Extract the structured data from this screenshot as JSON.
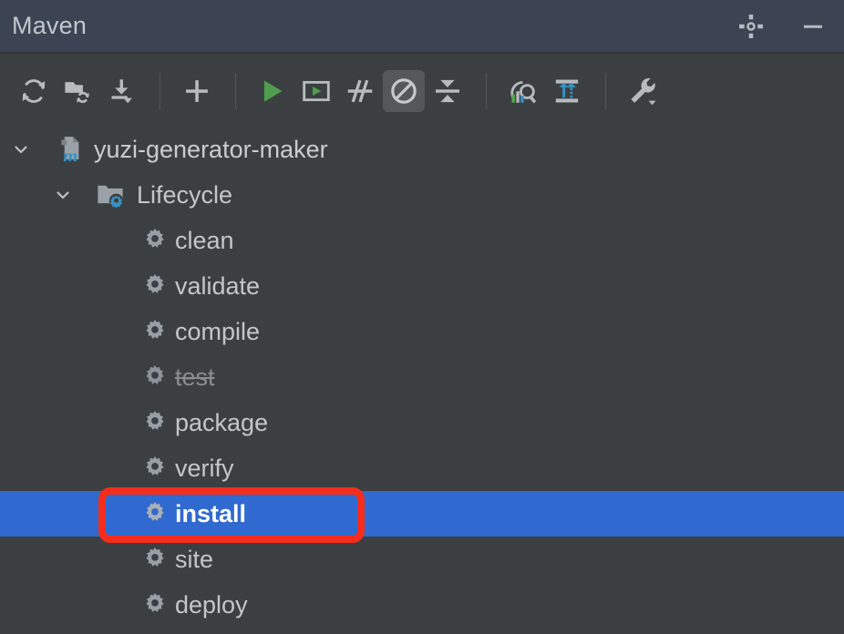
{
  "window": {
    "title": "Maven",
    "actions": [
      {
        "name": "settings-button",
        "icon": "gear-icon"
      },
      {
        "name": "minimize-button",
        "icon": "minimize-icon"
      }
    ]
  },
  "toolbar": {
    "items": [
      {
        "name": "reload-projects-button",
        "icon": "refresh-icon",
        "label": "Reload All Maven Projects",
        "active": false
      },
      {
        "name": "generate-sources-button",
        "icon": "folder-refresh-icon",
        "label": "Generate Sources and Update Folders",
        "active": false
      },
      {
        "name": "download-sources-button",
        "icon": "download-icon",
        "label": "Download Sources and Documentation",
        "active": false
      },
      {
        "name": "add-maven-project-button",
        "icon": "plus-icon",
        "label": "Add Maven Projects",
        "active": false
      },
      {
        "name": "run-maven-build-button",
        "icon": "run-triangle-icon",
        "label": "Run Maven Build",
        "active": false
      },
      {
        "name": "execute-goal-button",
        "icon": "execute-window-icon",
        "label": "Execute Maven Goal",
        "active": false
      },
      {
        "name": "toggle-skip-tests-button",
        "icon": "skip-tests-icon",
        "label": "Toggle 'Skip Tests' Mode",
        "active": false
      },
      {
        "name": "toggle-offline-mode-button",
        "icon": "offline-circle-slash-icon",
        "label": "Toggle Offline Mode",
        "active": true
      },
      {
        "name": "collapse-all-button",
        "icon": "collapse-all-icon",
        "label": "Collapse All",
        "active": false
      },
      {
        "name": "analyze-dependencies-button",
        "icon": "analyze-magnifier-icon",
        "label": "Analyze Dependencies",
        "active": false
      },
      {
        "name": "show-dependency-diagram-button",
        "icon": "dependency-diagram-icon",
        "label": "Show Dependencies",
        "active": false
      },
      {
        "name": "maven-settings-button",
        "icon": "wrench-dropdown-icon",
        "label": "Maven Settings",
        "active": false
      }
    ]
  },
  "tree": {
    "project": {
      "name": "yuzi-generator-maker",
      "icon": "maven-module-icon",
      "expanded": true,
      "chevron": "chevron-down-icon"
    },
    "lifecycle": {
      "name": "Lifecycle",
      "icon": "lifecycle-folder-icon",
      "expanded": true,
      "chevron": "chevron-down-icon"
    },
    "goals": [
      {
        "name": "clean",
        "icon": "gear-icon",
        "selected": false,
        "struck": false
      },
      {
        "name": "validate",
        "icon": "gear-icon",
        "selected": false,
        "struck": false
      },
      {
        "name": "compile",
        "icon": "gear-icon",
        "selected": false,
        "struck": false
      },
      {
        "name": "test",
        "icon": "gear-icon",
        "selected": false,
        "struck": true
      },
      {
        "name": "package",
        "icon": "gear-icon",
        "selected": false,
        "struck": false
      },
      {
        "name": "verify",
        "icon": "gear-icon",
        "selected": false,
        "struck": false
      },
      {
        "name": "install",
        "icon": "gear-icon",
        "selected": true,
        "struck": false
      },
      {
        "name": "site",
        "icon": "gear-icon",
        "selected": false,
        "struck": false
      },
      {
        "name": "deploy",
        "icon": "gear-icon",
        "selected": false,
        "struck": false
      }
    ]
  },
  "annotation": {
    "name": "install-highlight-box",
    "color": "#f42d1c",
    "target": "install"
  },
  "colors": {
    "titlebar_bg": "#3c4453",
    "panel_bg": "#3c3f41",
    "selection_blue": "#3069cf",
    "text": "#c3c7cc",
    "text_muted": "#8a8d90",
    "accent_blue": "#3592c4",
    "run_green": "#50a14f",
    "annotation_red": "#f42d1c"
  }
}
